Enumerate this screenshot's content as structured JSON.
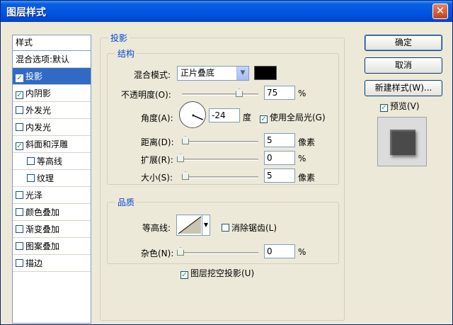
{
  "window": {
    "title": "图层样式",
    "close_glyph": "✕"
  },
  "style_list": {
    "header": "样式",
    "blend_options": "混合选项:默认",
    "items": [
      {
        "label": "投影",
        "checked": true,
        "selected": true,
        "indent": false
      },
      {
        "label": "内阴影",
        "checked": true,
        "selected": false,
        "indent": false
      },
      {
        "label": "外发光",
        "checked": false,
        "selected": false,
        "indent": false
      },
      {
        "label": "内发光",
        "checked": false,
        "selected": false,
        "indent": false
      },
      {
        "label": "斜面和浮雕",
        "checked": true,
        "selected": false,
        "indent": false
      },
      {
        "label": "等高线",
        "checked": false,
        "selected": false,
        "indent": true
      },
      {
        "label": "纹理",
        "checked": false,
        "selected": false,
        "indent": true
      },
      {
        "label": "光泽",
        "checked": false,
        "selected": false,
        "indent": false
      },
      {
        "label": "颜色叠加",
        "checked": false,
        "selected": false,
        "indent": false
      },
      {
        "label": "渐变叠加",
        "checked": false,
        "selected": false,
        "indent": false
      },
      {
        "label": "图案叠加",
        "checked": false,
        "selected": false,
        "indent": false
      },
      {
        "label": "描边",
        "checked": false,
        "selected": false,
        "indent": false
      }
    ]
  },
  "drop_shadow": {
    "title": "投影",
    "structure": {
      "title": "结构",
      "blend_mode_label": "混合模式:",
      "blend_mode_value": "正片叠底",
      "shadow_color": "#000000",
      "opacity_label": "不透明度(O):",
      "opacity_value": "75",
      "opacity_fraction": 0.75,
      "opacity_unit": "%",
      "angle_label": "角度(A):",
      "angle_value": "-24",
      "angle_unit": "度",
      "global_light_label": "使用全局光(G)",
      "global_light_checked": true,
      "distance_label": "距离(D):",
      "distance_value": "5",
      "distance_unit": "像素",
      "spread_label": "扩展(R):",
      "spread_value": "0",
      "spread_unit": "%",
      "size_label": "大小(S):",
      "size_value": "5",
      "size_unit": "像素"
    },
    "quality": {
      "title": "品质",
      "contour_label": "等高线:",
      "antialias_label": "消除锯齿(L)",
      "antialias_checked": false,
      "noise_label": "杂色(N):",
      "noise_value": "0",
      "noise_unit": "%"
    },
    "knockout_label": "图层挖空投影(U)",
    "knockout_checked": true
  },
  "buttons": {
    "ok": "确定",
    "cancel": "取消",
    "new_style": "新建样式(W)...",
    "preview_label": "预览(V)",
    "preview_checked": true
  },
  "colors": {
    "selection": "#316ac5",
    "group_title": "#0046d5",
    "dialog_bg": "#ece9d8"
  }
}
